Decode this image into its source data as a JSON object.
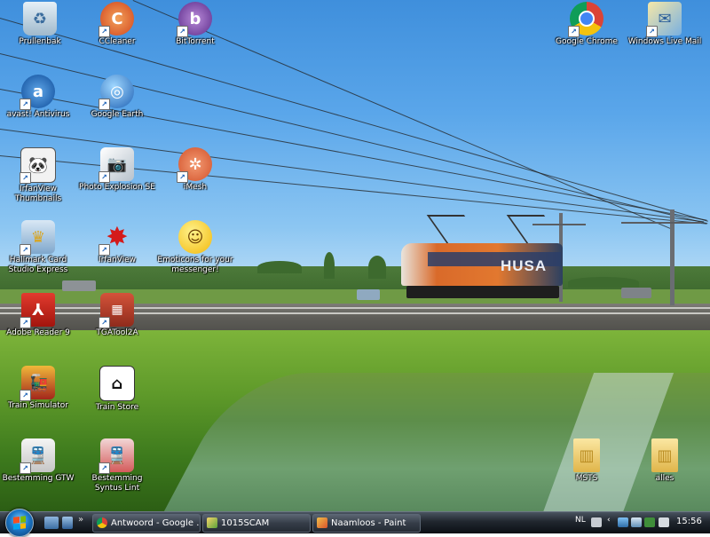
{
  "desktop": {
    "icons": [
      {
        "label": "Prullenbak",
        "icon": "recycle-bin-icon"
      },
      {
        "label": "CCleaner",
        "icon": "ccleaner-icon"
      },
      {
        "label": "BitTorrent",
        "icon": "bittorrent-icon"
      },
      {
        "label": "Google Chrome",
        "icon": "chrome-icon"
      },
      {
        "label": "Windows Live Mail",
        "icon": "windows-live-mail-icon"
      },
      {
        "label": "avast! Antivirus",
        "icon": "avast-icon"
      },
      {
        "label": "Google Earth",
        "icon": "google-earth-icon"
      },
      {
        "label": "IrfanView Thumbnails",
        "icon": "irfanview-thumbnails-icon"
      },
      {
        "label": "Photo Explosion SE",
        "icon": "photo-explosion-icon"
      },
      {
        "label": "iMesh",
        "icon": "imesh-icon"
      },
      {
        "label": "Hallmark Card Studio Express",
        "icon": "hallmark-icon"
      },
      {
        "label": "IrfanView",
        "icon": "irfanview-icon"
      },
      {
        "label": "Emoticons for your messenger!",
        "icon": "emoticon-icon"
      },
      {
        "label": "Adobe Reader 9",
        "icon": "adobe-reader-icon"
      },
      {
        "label": "TGATool2A",
        "icon": "tgatool-icon"
      },
      {
        "label": "Train Simulator",
        "icon": "train-simulator-icon"
      },
      {
        "label": "Train Store",
        "icon": "train-store-icon"
      },
      {
        "label": "Bestemming GTW",
        "icon": "train-gtw-icon"
      },
      {
        "label": "Bestemming Syntus Lint",
        "icon": "train-lint-icon"
      },
      {
        "label": "MSTS",
        "icon": "folder-icon"
      },
      {
        "label": "alles",
        "icon": "folder-icon"
      }
    ]
  },
  "wallpaper": {
    "locomotive_text": "HUSA"
  },
  "taskbar": {
    "tasks": [
      {
        "label": "Antwoord - Google ...",
        "icon": "chrome-icon"
      },
      {
        "label": "1015SCAM",
        "icon": "image-file-icon"
      },
      {
        "label": "Naamloos - Paint",
        "icon": "paint-icon"
      }
    ],
    "quick_launch_chevron": "»",
    "tray": {
      "language": "NL",
      "clock": "15:56",
      "icons": [
        "keyboard-icon",
        "chevron-left-icon",
        "network-icon",
        "security-icon",
        "volume-icon",
        "power-icon"
      ]
    }
  },
  "colors": {
    "taskbar": "#0b0f14",
    "label_text": "#ffffff",
    "sky": "#5aa6ea",
    "grass": "#5f9a2a"
  }
}
